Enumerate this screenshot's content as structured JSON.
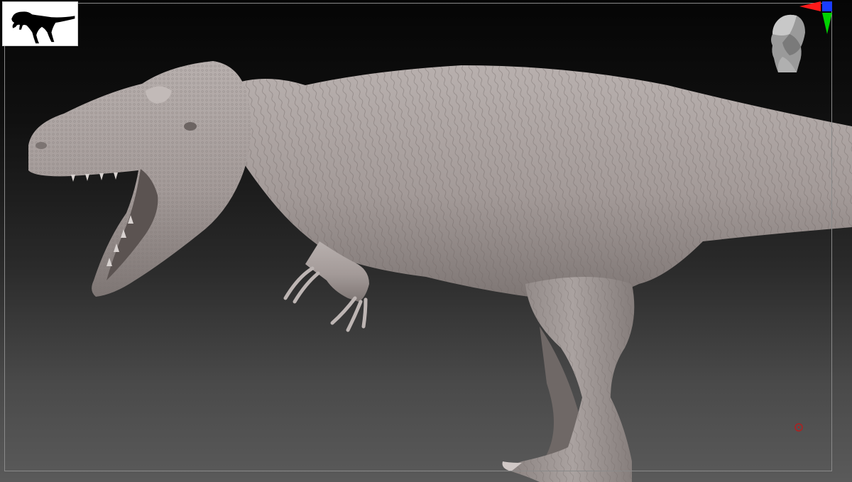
{
  "canvas": {
    "background_top": "#050505",
    "background_bottom": "#5a5a5a",
    "frame_color": "#8a8a8a"
  },
  "model": {
    "subject": "sculpted-theropod-dinosaur",
    "material_color": "#a49a98"
  },
  "thumbnail": {
    "icon": "dinosaur-silhouette-icon",
    "background": "#ffffff",
    "silhouette_color": "#000000"
  },
  "navigation": {
    "head_icon": "navigation-head-icon",
    "gizmo_icon": "axis-gizmo-icon",
    "axis_colors": {
      "x": "#ff1a1a",
      "y": "#00d200",
      "z": "#1a3cff"
    }
  },
  "pivot": {
    "icon": "pivot-marker-icon",
    "color": "#b02020"
  }
}
